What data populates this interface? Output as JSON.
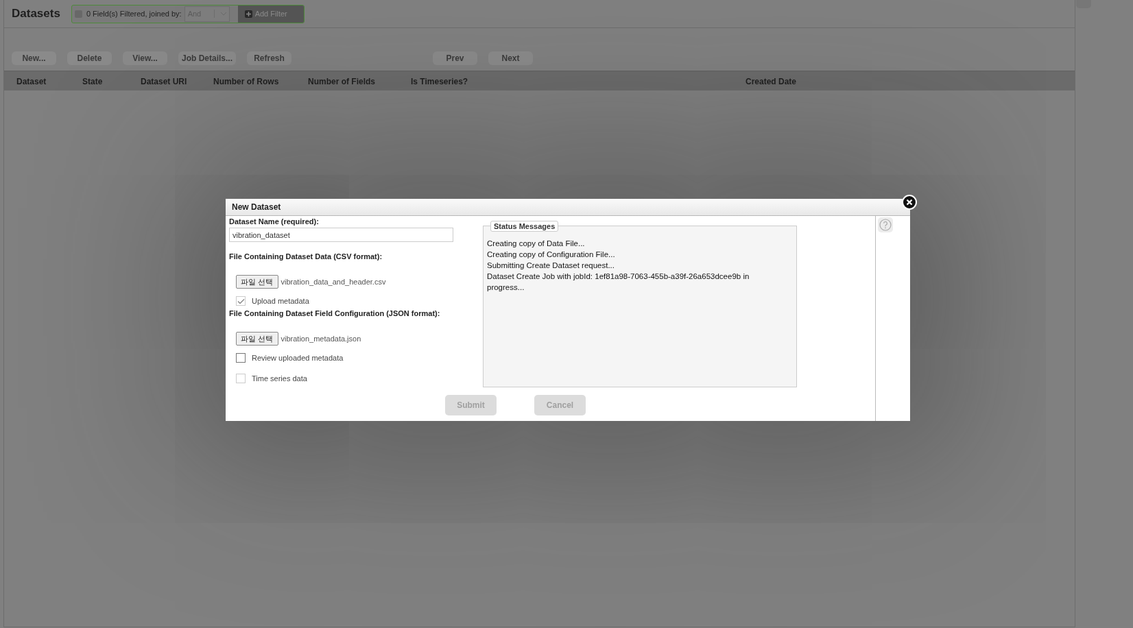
{
  "page": {
    "title": "Datasets",
    "filter": {
      "summary": "0 Field(s) Filtered, joined by:",
      "join": "And",
      "add_label": "Add Filter"
    },
    "toolbar": [
      {
        "label": "New..."
      },
      {
        "label": "Delete"
      },
      {
        "label": "View..."
      },
      {
        "label": "Job Details..."
      },
      {
        "label": "Refresh"
      }
    ],
    "pager": [
      {
        "label": "Prev"
      },
      {
        "label": "Next"
      }
    ],
    "table": {
      "columns": [
        "Dataset",
        "State",
        "Dataset URI",
        "Number of Rows",
        "Number of Fields",
        "Is Timeseries?",
        "Created Date"
      ]
    }
  },
  "dialog": {
    "title": "New Dataset",
    "name_label": "Dataset Name (required):",
    "name_value": "vibration_dataset",
    "data_file": {
      "label": "File Containing Dataset Data (CSV format):",
      "button": "파일 선택",
      "file": "vibration_data_and_header.csv"
    },
    "upload_metadata": {
      "label": "Upload metadata",
      "checked": true,
      "disabled": true
    },
    "config_file": {
      "label": "File Containing Dataset Field Configuration (JSON format):",
      "button": "파일 선택",
      "file": "vibration_metadata.json"
    },
    "options": [
      {
        "label": "Review uploaded metadata",
        "checked": false,
        "disabled": false
      },
      {
        "label": "Time series data",
        "checked": false,
        "disabled": true
      }
    ],
    "status": {
      "title": "Status Messages",
      "messages": [
        "Creating copy of Data File...",
        "Creating copy of Configuration File...",
        "Submitting Create Dataset request...",
        "Dataset Create Job with jobId: 1ef81a98-7063-455b-a39f-26a653dcee9b in progress..."
      ]
    },
    "buttons": [
      {
        "label": "Submit",
        "disabled": true
      },
      {
        "label": "Cancel",
        "disabled": true
      }
    ]
  }
}
